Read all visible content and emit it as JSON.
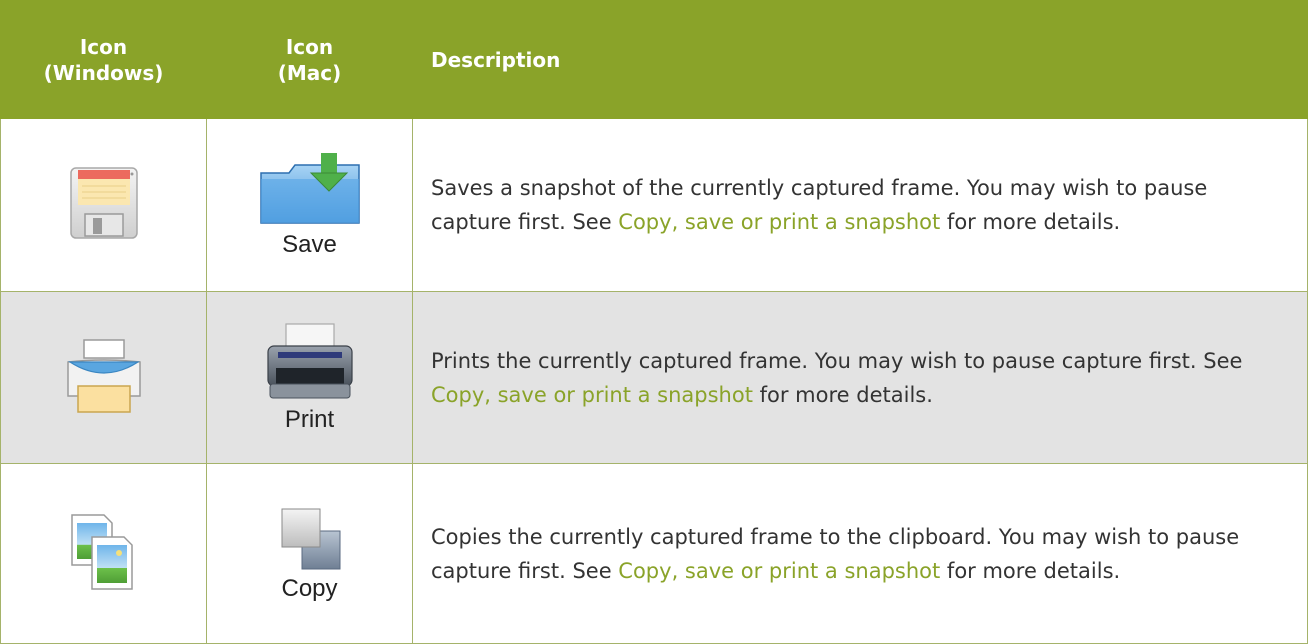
{
  "header": {
    "col1": "Icon\n(Windows)",
    "col1_line1": "Icon",
    "col1_line2": "(Windows)",
    "col2_line1": "Icon",
    "col2_line2": "(Mac)",
    "col3": "Description"
  },
  "rows": [
    {
      "win_icon": "save-floppy-icon",
      "mac_icon": "save-folder-icon",
      "mac_label": "Save",
      "desc_before": "Saves a snapshot of the currently captured frame. You may wish to pause capture first. See ",
      "link": "Copy, save or print a snapshot",
      "desc_after": " for more details."
    },
    {
      "win_icon": "print-printer-icon",
      "mac_icon": "print-printer-icon",
      "mac_label": "Print",
      "desc_before": "Prints the currently captured frame. You may wish to pause capture first. See ",
      "link": "Copy, save or print a snapshot",
      "desc_after": " for more details."
    },
    {
      "win_icon": "copy-images-icon",
      "mac_icon": "copy-squares-icon",
      "mac_label": "Copy",
      "desc_before": "Copies the currently captured frame to the clipboard. You may wish to pause capture first. See ",
      "link": "Copy, save or print a snapshot",
      "desc_after": " for more details."
    }
  ],
  "colors": {
    "header_bg": "#8aa329",
    "link": "#8aa329",
    "alt_row_bg": "#e3e3e3"
  }
}
